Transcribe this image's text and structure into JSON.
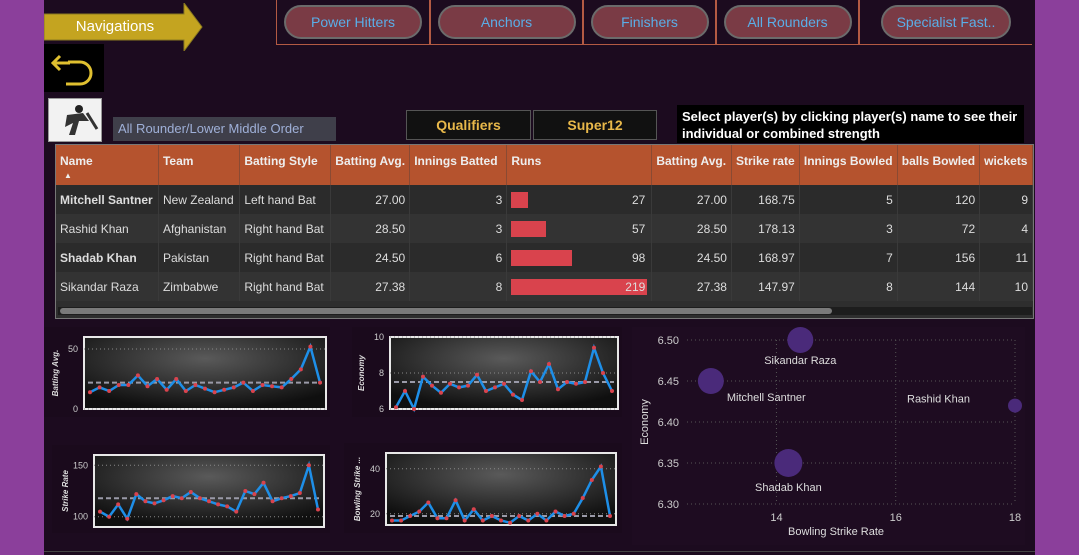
{
  "navigation": {
    "label": "Navigations"
  },
  "tabs": [
    {
      "label": "Power Hitters"
    },
    {
      "label": "Anchors"
    },
    {
      "label": "Finishers"
    },
    {
      "label": "All Rounders"
    },
    {
      "label": "Specialist Fast.."
    }
  ],
  "role_label": "All Rounder/Lower Middle Order",
  "stages": [
    {
      "label": "Qualifiers"
    },
    {
      "label": "Super12"
    }
  ],
  "instruction": "Select player(s) by clicking player(s) name to see their individual or combined strength",
  "table": {
    "headers": [
      "Name",
      "Team",
      "Batting Style",
      "Batting Avg.",
      "Innings Batted",
      "Runs",
      "Batting Avg.",
      "Strike rate",
      "Innings Bowled",
      "balls Bowled",
      "wickets"
    ],
    "rows": [
      [
        "Mitchell Santner",
        "New Zealand",
        "Left hand Bat",
        "27.00",
        "3",
        "27",
        "27.00",
        "168.75",
        "5",
        "120",
        "9"
      ],
      [
        "Rashid Khan",
        "Afghanistan",
        "Right hand Bat",
        "28.50",
        "3",
        "57",
        "28.50",
        "178.13",
        "3",
        "72",
        "4"
      ],
      [
        "Shadab Khan",
        "Pakistan",
        "Right hand Bat",
        "24.50",
        "6",
        "98",
        "24.50",
        "168.97",
        "7",
        "156",
        "11"
      ],
      [
        "Sikandar Raza",
        "Zimbabwe",
        "Right hand Bat",
        "27.38",
        "8",
        "219",
        "27.38",
        "147.97",
        "8",
        "144",
        "10"
      ]
    ],
    "runs_max": 219
  },
  "colors": {
    "accent": "#d9434d",
    "line": "#1e8fe8",
    "header": "#b5532e",
    "scatter": "#4a2a7a",
    "tab_text": "#5aaee8"
  },
  "chart_data": [
    {
      "type": "line",
      "ylabel": "Batting Avg.",
      "yticks": [
        "50",
        "0"
      ],
      "ylim": [
        0,
        60
      ],
      "values": [
        14,
        18,
        15,
        20,
        20,
        28,
        19,
        25,
        16,
        25,
        15,
        20,
        17,
        14,
        16,
        18,
        22,
        15,
        20,
        19,
        18,
        25,
        33,
        52,
        22
      ],
      "average": 22
    },
    {
      "type": "line",
      "ylabel": "Economy",
      "yticks": [
        "10",
        "8",
        "6"
      ],
      "ylim": [
        6,
        10
      ],
      "values": [
        6.1,
        7.0,
        6.0,
        7.8,
        7.3,
        6.9,
        7.4,
        7.2,
        7.3,
        7.9,
        7.0,
        7.2,
        7.4,
        6.8,
        6.5,
        8.1,
        7.5,
        8.5,
        7.1,
        7.5,
        7.4,
        7.5,
        9.4,
        8.0,
        7.0
      ],
      "average": 7.5
    },
    {
      "type": "line",
      "ylabel": "Strike Rate",
      "yticks": [
        "150",
        "100"
      ],
      "ylim": [
        90,
        160
      ],
      "values": [
        105,
        100,
        112,
        98,
        122,
        115,
        113,
        116,
        120,
        118,
        124,
        118,
        115,
        112,
        110,
        105,
        125,
        122,
        133,
        115,
        118,
        120,
        123,
        150,
        107
      ],
      "average": 118
    },
    {
      "type": "line",
      "ylabel": "Bowling Strike ...",
      "yticks": [
        "40",
        "20"
      ],
      "ylim": [
        15,
        47
      ],
      "values": [
        17,
        17,
        19,
        21,
        25,
        18,
        18,
        26,
        17,
        22,
        17,
        19,
        17,
        16,
        19,
        17,
        20,
        17,
        21,
        19,
        20,
        27,
        35,
        41,
        19
      ],
      "average": 19
    },
    {
      "type": "scatter",
      "xlabel": "Bowling Strike Rate",
      "ylabel": "Economy",
      "xticks": [
        "14",
        "16",
        "18"
      ],
      "yticks": [
        "6.50",
        "6.45",
        "6.40",
        "6.35",
        "6.30"
      ],
      "xlim": [
        12.5,
        18
      ],
      "ylim": [
        6.3,
        6.5
      ],
      "points": [
        {
          "name": "Sikandar Raza",
          "x": 14.4,
          "y": 6.5
        },
        {
          "name": "Mitchell Santner",
          "x": 12.9,
          "y": 6.45
        },
        {
          "name": "Rashid Khan",
          "x": 18.0,
          "y": 6.42
        },
        {
          "name": "Shadab Khan",
          "x": 14.2,
          "y": 6.35
        }
      ]
    }
  ]
}
